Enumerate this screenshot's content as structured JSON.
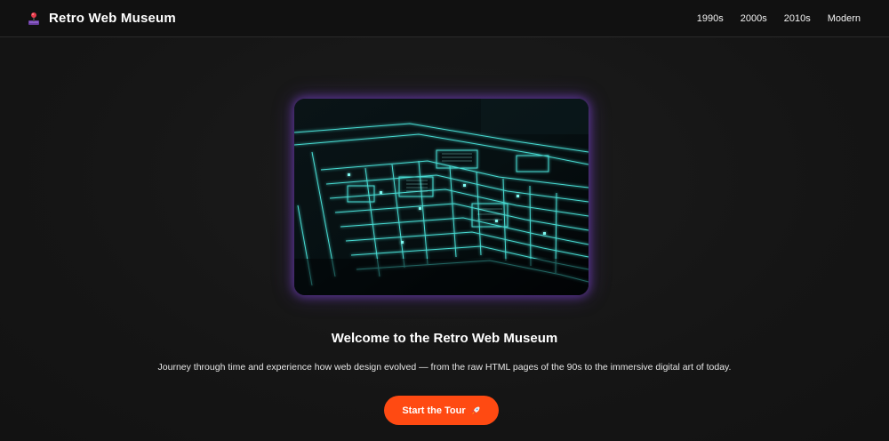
{
  "header": {
    "title": "Retro Web Museum",
    "logo_icon": "joystick-icon",
    "nav": [
      {
        "label": "1990s"
      },
      {
        "label": "2000s"
      },
      {
        "label": "2010s"
      },
      {
        "label": "Modern"
      }
    ]
  },
  "hero": {
    "image_subject": "glowing circuit board",
    "glow_color": "#7b45d6"
  },
  "main": {
    "heading": "Welcome to the Retro Web Museum",
    "intro": "Journey through time and experience how web design evolved — from the raw HTML pages of the 90s to the immersive digital art of today.",
    "cta_label": "Start the Tour",
    "cta_icon": "rocket-icon",
    "cta_color": "#ff4a12"
  }
}
